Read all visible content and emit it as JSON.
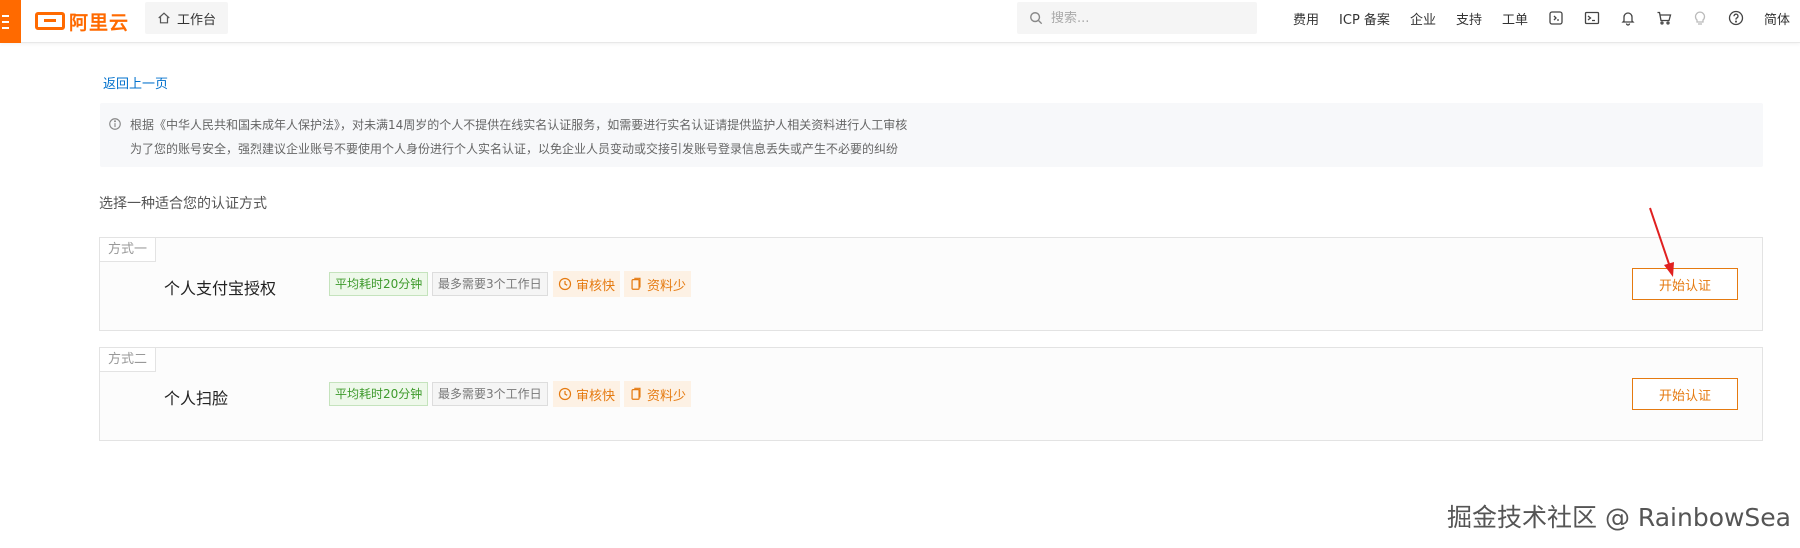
{
  "header": {
    "logo_text": "阿里云",
    "workbench_label": "工作台",
    "search_placeholder": "搜索...",
    "nav": [
      "费用",
      "ICP 备案",
      "企业",
      "支持",
      "工单"
    ],
    "language": "简体",
    "brand_color": "#ff6a00"
  },
  "back_link": "返回上一页",
  "notice": {
    "line1": "根据《中华人民共和国未成年人保护法》，对未满14周岁的个人不提供在线实名认证服务，如需要进行实名认证请提供监护人相关资料进行人工审核",
    "line2": "为了您的账号安全，强烈建议企业账号不要使用个人身份进行个人实名认证，以免企业人员变动或交接引发账号登录信息丢失或产生不必要的纠纷"
  },
  "section_title": "选择一种适合您的认证方式",
  "methods": [
    {
      "label": "方式一",
      "title": "个人支付宝授权",
      "tag_time": "平均耗时20分钟",
      "tag_days": "最多需要3个工作日",
      "feature_fast": "审核快",
      "feature_less": "资料少",
      "button": "开始认证"
    },
    {
      "label": "方式二",
      "title": "个人扫脸",
      "tag_time": "平均耗时20分钟",
      "tag_days": "最多需要3个工作日",
      "feature_fast": "审核快",
      "feature_less": "资料少",
      "button": "开始认证"
    }
  ],
  "watermark": "掘金技术社区 @ RainbowSea",
  "accent_color": "#e57a10"
}
